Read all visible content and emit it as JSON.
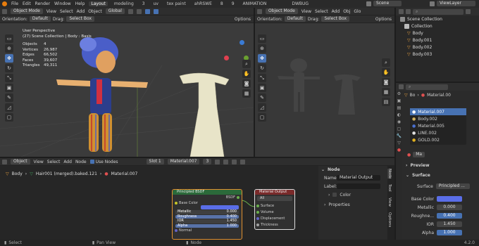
{
  "topbar": {
    "menus": [
      "File",
      "Edit",
      "Render",
      "Window",
      "Help"
    ],
    "tabs": [
      "Layout",
      "modeling",
      "3",
      "uv",
      "tex paint",
      "ahRSWE",
      "8",
      "9",
      "ANIMATION",
      "DWBUG"
    ],
    "active_tab": "Layout",
    "scene": "Scene",
    "view_layer": "ViewLayer"
  },
  "viewport_left": {
    "mode": "Object Mode",
    "menus": [
      "View",
      "Select",
      "Add",
      "Object"
    ],
    "transform": "Global",
    "orientation_label": "Orientation:",
    "orientation_value": "Default",
    "drag_label": "Drag:",
    "drag_value": "Select Box",
    "options_label": "Options",
    "view_name": "User Perspective",
    "collection_path": "(27) Scene Collection | Body : Basis",
    "stats": [
      {
        "label": "Objects",
        "value": "4"
      },
      {
        "label": "Vertices",
        "value": "26,987"
      },
      {
        "label": "Edges",
        "value": "66,502"
      },
      {
        "label": "Faces",
        "value": "39,607"
      },
      {
        "label": "Triangles",
        "value": "49,311"
      }
    ]
  },
  "viewport_right": {
    "mode": "Object Mode",
    "menus": [
      "View",
      "Select",
      "Add",
      "Obj"
    ],
    "transform": "Glo",
    "orientation_label": "Orientation:",
    "orientation_value": "Default",
    "drag_label": "Drag:",
    "drag_value": "Select Box",
    "options_label": "Options"
  },
  "outliner": {
    "root": "Scene Collection",
    "items": [
      "Collection",
      "Body",
      "Body.001",
      "Body.002",
      "Body.003"
    ]
  },
  "material_list": {
    "object": "Bo",
    "material": "Material.00",
    "slots": [
      "Material.007",
      "Body.002",
      "Material.005",
      "LINE.002",
      "GOLD.002"
    ]
  },
  "material_props": {
    "name": "Ma",
    "sections": [
      "Preview",
      "Surface"
    ],
    "surface_label": "Surface",
    "surface_value": "Principled ...",
    "rows": [
      {
        "label": "Base Color",
        "value": ""
      },
      {
        "label": "Metallic",
        "value": "0.000"
      },
      {
        "label": "Roughne...",
        "value": "0.400"
      },
      {
        "label": "IOR",
        "value": "1.450"
      },
      {
        "label": "Alpha",
        "value": "1.000"
      }
    ]
  },
  "node_editor": {
    "menus": [
      "Object",
      "View",
      "Select",
      "Add",
      "Node"
    ],
    "use_nodes": "Use Nodes",
    "slot": "Slot 1",
    "material": "Material.007",
    "users": "3",
    "breadcrumb": [
      "Body",
      "Hair001 (merged).baked.121",
      "Material.007"
    ],
    "bsdf": {
      "title": "Principled BSDF",
      "output": "BSDF",
      "rows": [
        {
          "label": "Base Color",
          "value": ""
        },
        {
          "label": "Metallic",
          "value": "0.000"
        },
        {
          "label": "Roughness",
          "value": "0.400"
        },
        {
          "label": "IOR",
          "value": "1.450"
        },
        {
          "label": "Alpha",
          "value": "1.000"
        },
        {
          "label": "Normal",
          "value": ""
        }
      ]
    },
    "output_node": {
      "title": "Material Output",
      "target": "All",
      "inputs": [
        "Surface",
        "Volume",
        "Displacement",
        "Thickness"
      ]
    }
  },
  "node_panel": {
    "header": "Node",
    "name_label": "Name:",
    "name_value": "Material Output",
    "label_label": "Label:",
    "color_label": "Color",
    "properties_label": "Properties",
    "side_tabs": [
      "Node",
      "Tool",
      "View",
      "Options"
    ]
  },
  "statusbar": {
    "items": [
      "Select",
      "Pan View",
      "Node"
    ],
    "version": "4.2.0"
  },
  "colors": {
    "accent": "#4772b3",
    "header": "#2e2e2e",
    "viewport": "#3b3b3b"
  }
}
